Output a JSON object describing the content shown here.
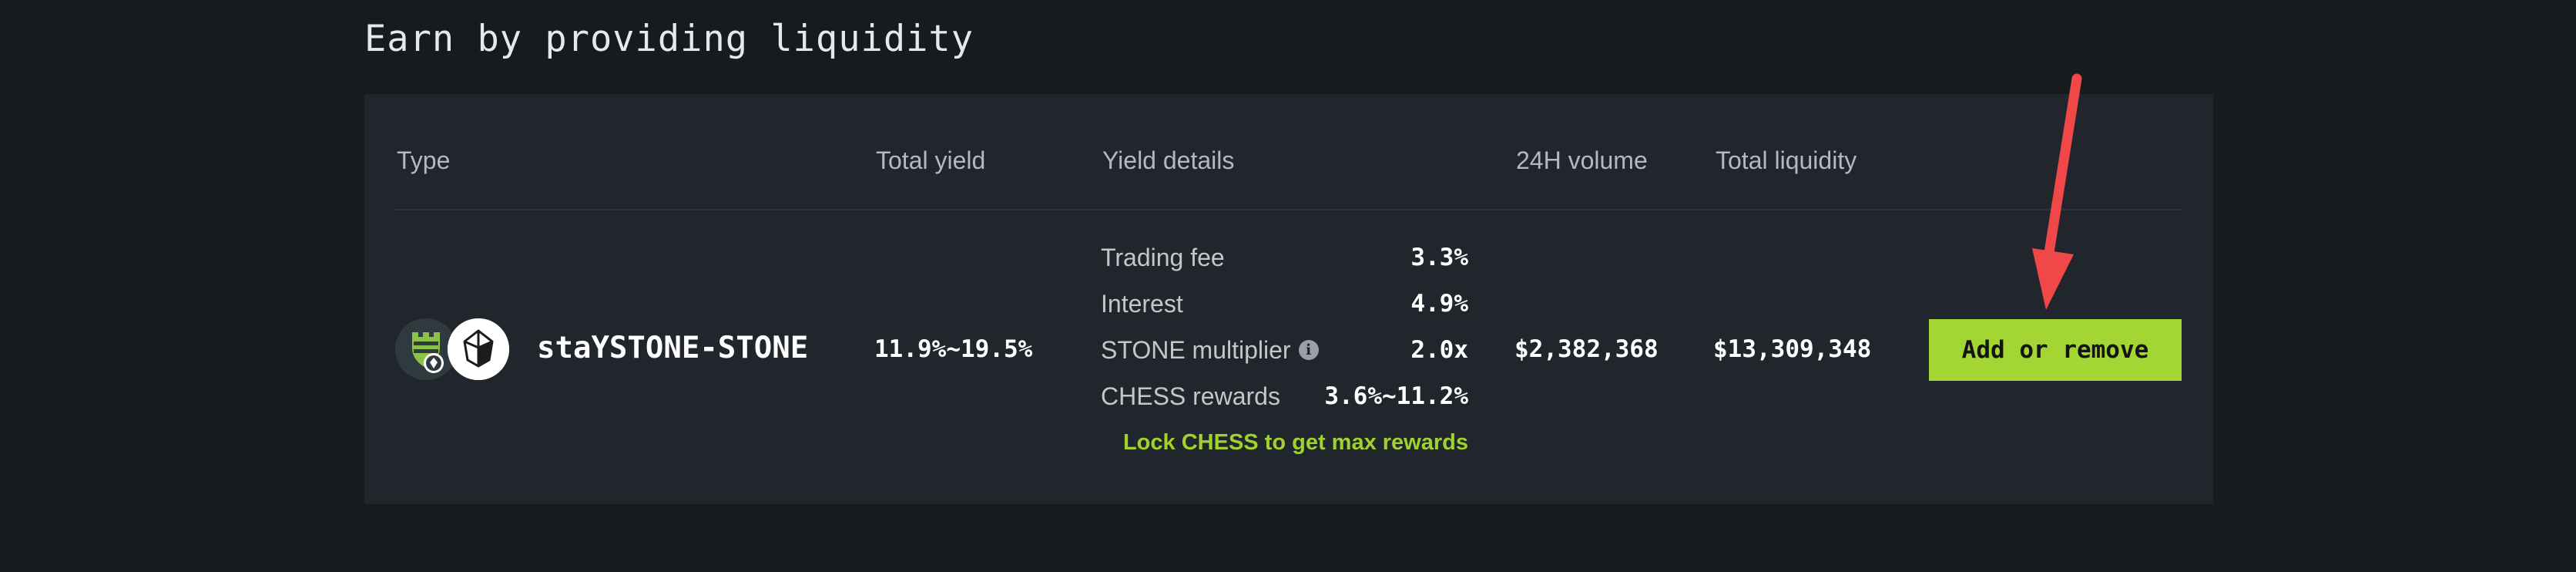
{
  "section": {
    "title": "Earn by providing liquidity"
  },
  "table": {
    "headers": {
      "type": "Type",
      "total_yield": "Total yield",
      "yield_details": "Yield details",
      "volume_24h": "24H volume",
      "total_liquidity": "Total liquidity"
    },
    "row": {
      "pair_name": "staYSTONE-STONE",
      "total_yield": "11.9%~19.5%",
      "yield_details": {
        "trading_fee_label": "Trading fee",
        "trading_fee_value": "3.3%",
        "interest_label": "Interest",
        "interest_value": "4.9%",
        "multiplier_label": "STONE multiplier",
        "multiplier_value": "2.0x",
        "chess_label": "CHESS rewards",
        "chess_value": "3.6%~11.2%"
      },
      "lock_link": "Lock CHESS to get max rewards",
      "volume_24h": "$2,382,368",
      "total_liquidity": "$13,309,348",
      "action_label": "Add or remove"
    }
  },
  "icons": {
    "token_a": "shield-chess-token-icon",
    "token_b": "stone-gem-token-icon",
    "info": "info-icon",
    "annotation": "red-arrow-annotation"
  },
  "colors": {
    "background": "#171b1e",
    "card": "#20262c",
    "accent_green": "#a3d632",
    "link_green": "#a0d12f",
    "arrow_red": "#f04848"
  }
}
